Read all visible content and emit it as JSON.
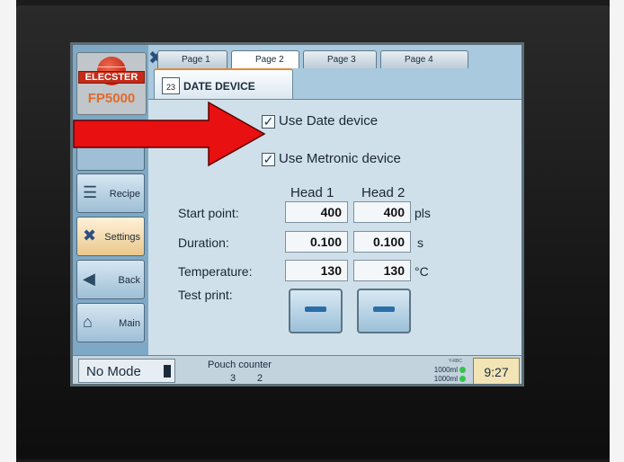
{
  "brand": {
    "name": "ELECSTER",
    "model": "FP5000"
  },
  "tabs": [
    {
      "label": "Page 1"
    },
    {
      "label": "Page 2"
    },
    {
      "label": "Page 3"
    },
    {
      "label": "Page 4"
    }
  ],
  "panel": {
    "title": "DATE DEVICE",
    "calendar_day": "23"
  },
  "options": {
    "use_date_device": {
      "label": "Use Date device",
      "checked": true
    },
    "use_metronic_device": {
      "label": "Use Metronic device",
      "checked": true
    }
  },
  "table": {
    "head1": "Head 1",
    "head2": "Head 2",
    "rows": [
      {
        "label": "Start point:",
        "h1": "400",
        "h2": "400",
        "unit": "pls"
      },
      {
        "label": "Duration:",
        "h1": "0.100",
        "h2": "0.100",
        "unit": "s"
      },
      {
        "label": "Temperature:",
        "h1": "130",
        "h2": "130",
        "unit": "°C"
      }
    ],
    "test_print_label": "Test print:"
  },
  "sidebar": {
    "recipe": "Recipe",
    "settings": "Settings",
    "back": "Back",
    "main": "Main"
  },
  "bottom": {
    "mode": "No Mode",
    "pouch_counter_label": "Pouch counter",
    "pouch_counter_1": "3",
    "pouch_counter_2": "2",
    "small_label": "Y-RBC",
    "flow_1": "1000ml",
    "flow_2": "1000ml",
    "time": "9:27"
  },
  "colors": {
    "arrow": "#e81010",
    "accent": "#e08a3a",
    "status_ok": "#38c14a"
  }
}
